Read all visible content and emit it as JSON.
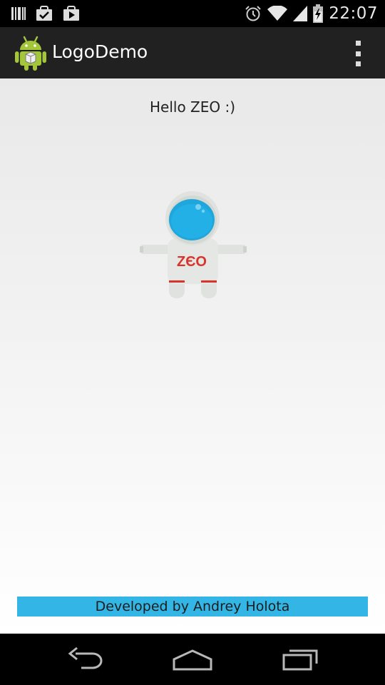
{
  "status_bar": {
    "time": "22:07",
    "left_icons": [
      "barcode-icon",
      "shopping-bag-check-icon",
      "play-store-icon"
    ],
    "right_icons": [
      "alarm-icon",
      "wifi-icon",
      "signal-icon",
      "battery-charging-icon"
    ]
  },
  "action_bar": {
    "title": "LogoDemo",
    "app_icon": "android-app-icon",
    "overflow_icon": "overflow-menu-icon"
  },
  "main": {
    "greeting": "Hello ZEO :)",
    "logo_text": "ZЄO",
    "footer": "Developed by Andrey Holota"
  },
  "nav_bar": {
    "buttons": [
      "back-icon",
      "home-icon",
      "recent-apps-icon"
    ]
  },
  "colors": {
    "footer_accent": "#33b5e5",
    "action_bar": "#212121",
    "helmet_visor": "#1fa7dd",
    "logo_red": "#d9342b"
  }
}
